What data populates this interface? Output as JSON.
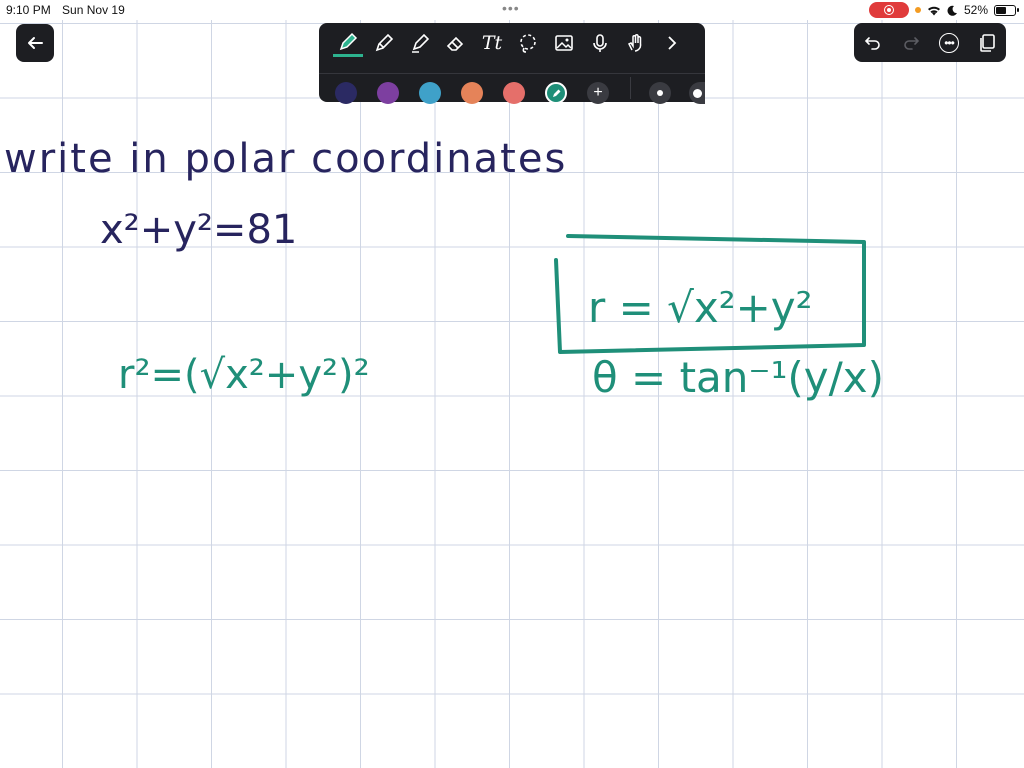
{
  "status_bar": {
    "time": "9:10 PM",
    "date": "Sun Nov 19",
    "battery": "52%"
  },
  "colors": {
    "toolbar_bg": "#1d1e22",
    "ink_navy": "#27245e",
    "ink_teal": "#1f8f79",
    "grid": "#cfd6e4"
  },
  "icons": {
    "back": "arrow-left-icon",
    "tools": [
      "pen-icon",
      "pencil-icon",
      "highlighter-icon",
      "eraser-icon",
      "text-icon",
      "lasso-icon",
      "image-icon",
      "microphone-icon",
      "hand-icon",
      "chevron-right-icon"
    ],
    "right": [
      "undo-icon",
      "redo-icon",
      "more-icon",
      "pages-icon"
    ]
  },
  "toolbar": {
    "text_tool_label": "Tt",
    "swatches": [
      "#2b2a63",
      "#7d3fa0",
      "#3fa1c9",
      "#e58359",
      "#e56f6a",
      "#1e8f78"
    ]
  },
  "note": {
    "line1": "write in polar coordinates",
    "line2": "x²+y²=81",
    "line3": "r²=(√x²+y²)²",
    "boxed": "r = √x²+y²",
    "theta": "θ = tan⁻¹(y/x)"
  }
}
